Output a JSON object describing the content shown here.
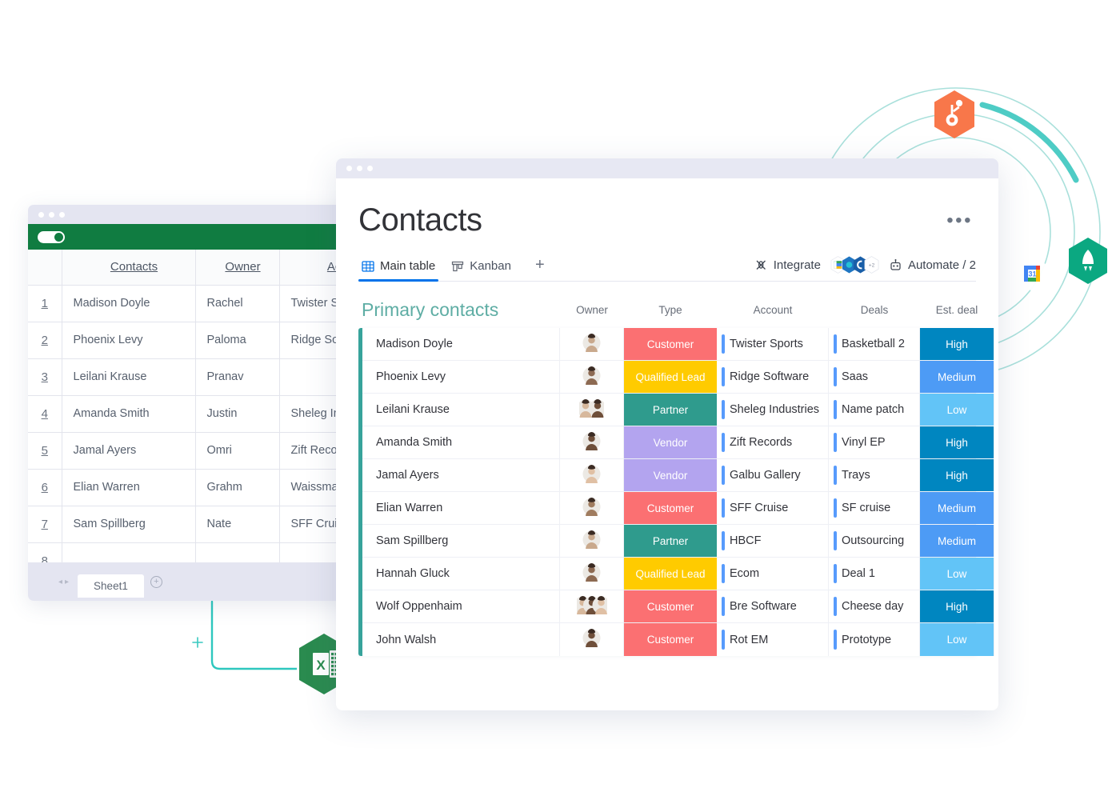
{
  "spreadsheet": {
    "window_dots": 3,
    "toolbar_color": "#107c41",
    "headers": [
      "",
      "Contacts",
      "Owner",
      "Account"
    ],
    "rows": [
      {
        "idx": "1",
        "contact": "Madison Doyle",
        "owner": "Rachel",
        "account": "Twister Sports"
      },
      {
        "idx": "2",
        "contact": "Phoenix Levy",
        "owner": "Paloma",
        "account": "Ridge Software"
      },
      {
        "idx": "3",
        "contact": "Leilani Krause",
        "owner": "Pranav",
        "account": ""
      },
      {
        "idx": "4",
        "contact": "Amanda Smith",
        "owner": "Justin",
        "account": "Sheleg Industries"
      },
      {
        "idx": "5",
        "contact": "Jamal Ayers",
        "owner": "Omri",
        "account": "Zift Records"
      },
      {
        "idx": "6",
        "contact": "Elian Warren",
        "owner": "Grahm",
        "account": "Waissman Gallery"
      },
      {
        "idx": "7",
        "contact": "Sam Spillberg",
        "owner": "Nate",
        "account": "SFF Cruise"
      },
      {
        "idx": "8",
        "contact": "",
        "owner": "",
        "account": ""
      }
    ],
    "footer": {
      "sheet_tab": "Sheet1",
      "add_sheet": "+"
    }
  },
  "board": {
    "title": "Contacts",
    "overflow_menu": "•••",
    "tabs": [
      {
        "label": "Main table",
        "icon": "table-icon",
        "active": true
      },
      {
        "label": "Kanban",
        "icon": "kanban-icon",
        "active": false
      }
    ],
    "add_tab": "+",
    "integrate_label": "Integrate",
    "integrate_badge": "+2",
    "automate_label": "Automate / 2",
    "accent_color": "#0073ea"
  },
  "table": {
    "group_title": "Primary contacts",
    "group_color": "#5eada4",
    "columns": [
      "Owner",
      "Type",
      "Account",
      "Deals",
      "Est. deal"
    ],
    "add_column": "+",
    "type_colors": {
      "Customer": "#fb7072",
      "Qualified Lead": "#ffcb00",
      "Partner": "#2f9b8d",
      "Vendor": "#b3a4ef"
    },
    "est_colors": {
      "High": "#0086c0",
      "Medium": "#4d9bf5",
      "Low": "#62c4f7"
    },
    "rows": [
      {
        "name": "Madison Doyle",
        "owner": "avatar-single",
        "type": "Customer",
        "account": "Twister Sports",
        "deal": "Basketball 2",
        "est": "High"
      },
      {
        "name": "Phoenix Levy",
        "owner": "avatar-single",
        "type": "Qualified Lead",
        "account": "Ridge Software",
        "deal": "Saas",
        "est": "Medium"
      },
      {
        "name": "Leilani Krause",
        "owner": "avatar-double",
        "type": "Partner",
        "account": "Sheleg Industries",
        "deal": "Name patch",
        "est": "Low"
      },
      {
        "name": "Amanda Smith",
        "owner": "avatar-single",
        "type": "Vendor",
        "account": "Zift Records",
        "deal": "Vinyl EP",
        "est": "High"
      },
      {
        "name": "Jamal Ayers",
        "owner": "avatar-single",
        "type": "Vendor",
        "account": "Galbu Gallery",
        "deal": "Trays",
        "est": "High"
      },
      {
        "name": "Elian Warren",
        "owner": "avatar-single",
        "type": "Customer",
        "account": "SFF Cruise",
        "deal": "SF cruise",
        "est": "Medium"
      },
      {
        "name": "Sam Spillberg",
        "owner": "avatar-single",
        "type": "Partner",
        "account": "HBCF",
        "deal": "Outsourcing",
        "est": "Medium"
      },
      {
        "name": "Hannah Gluck",
        "owner": "avatar-single",
        "type": "Qualified Lead",
        "account": "Ecom",
        "deal": "Deal 1",
        "est": "Low"
      },
      {
        "name": "Wolf Oppenhaim",
        "owner": "avatar-triple",
        "type": "Customer",
        "account": "Bre Software",
        "deal": "Cheese day",
        "est": "High"
      },
      {
        "name": "John Walsh",
        "owner": "avatar-single",
        "type": "Customer",
        "account": "Rot EM",
        "deal": "Prototype",
        "est": "Low"
      }
    ]
  },
  "decorations": {
    "excel_icon": "excel-icon",
    "hubspot_icon": "hubspot-icon",
    "google_calendar_icon": "google-calendar-icon",
    "mailchimp_icon": "rocket-icon",
    "connector_color": "#1ec2b8",
    "ring_color": "#9fdcd6"
  }
}
